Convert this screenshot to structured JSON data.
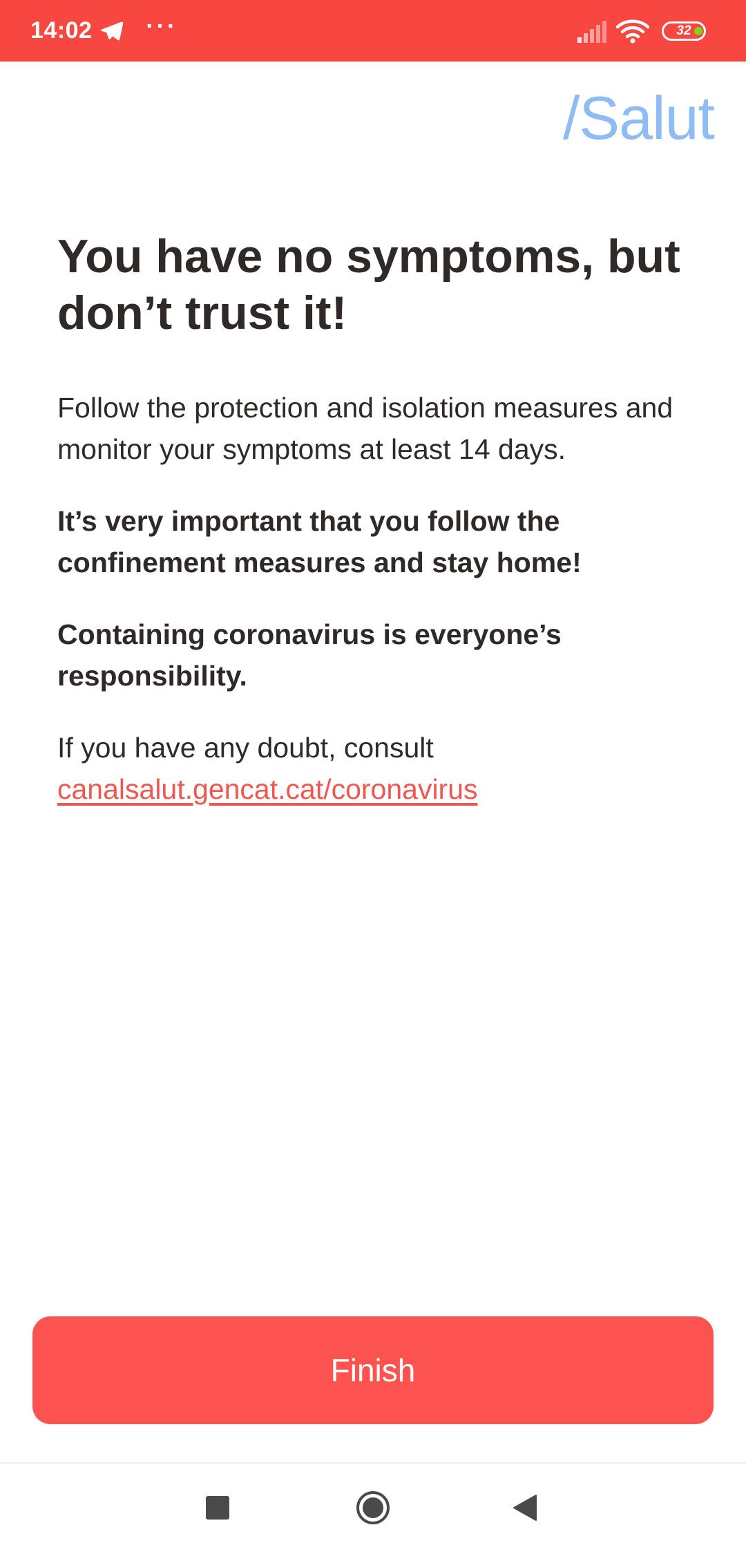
{
  "status_bar": {
    "time": "14:02",
    "more": "···",
    "battery_level": "32",
    "background_color": "#f84640",
    "icons": [
      "telegram-icon",
      "signal-icon",
      "wifi-icon",
      "battery-icon"
    ]
  },
  "brand": {
    "logo_text": "/Salut",
    "color": "#8fbcf2"
  },
  "content": {
    "headline": "You have no symptoms, but don’t trust it!",
    "paragraph_1": "Follow the protection and isolation measures and monitor your symptoms at least 14 days.",
    "paragraph_2": "It’s very important that you follow the confinement measures and stay home!",
    "paragraph_3": "Containing coronavirus is everyone’s responsibility.",
    "paragraph_4_prefix": "If you have any doubt, consult",
    "link_text": "canalsalut.gencat.cat/coronavirus",
    "link_color": "#f0574f"
  },
  "actions": {
    "finish_label": "Finish",
    "button_color": "#fc5351"
  },
  "nav_bar": {
    "icons": [
      "recents-square-icon",
      "home-circle-icon",
      "back-triangle-icon"
    ]
  }
}
